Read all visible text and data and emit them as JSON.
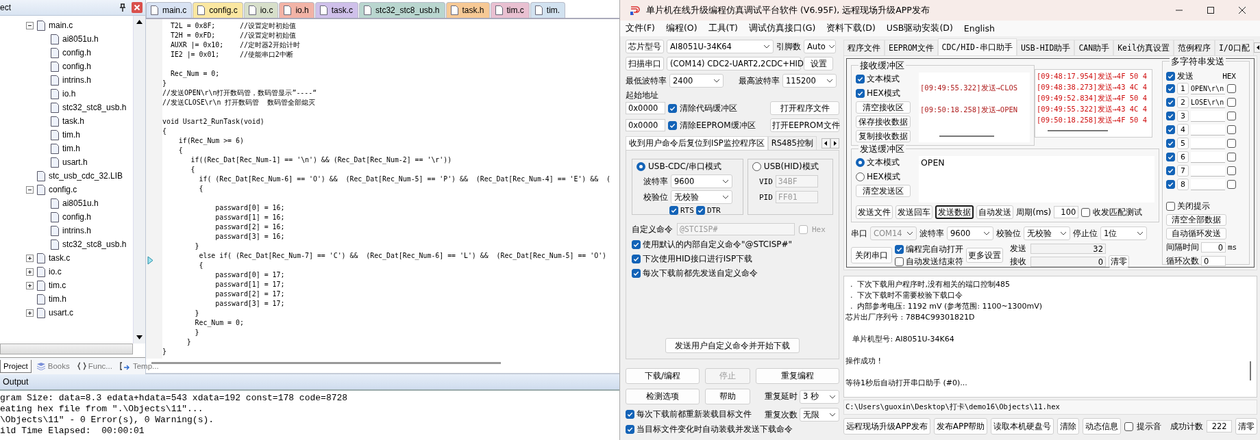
{
  "ide": {
    "project_panel": {
      "title": "ect",
      "tree": [
        {
          "label": "main.c",
          "expanded": true,
          "children": [
            {
              "label": "ai8051u.h"
            },
            {
              "label": "config.h"
            },
            {
              "label": "config.h"
            },
            {
              "label": "intrins.h"
            },
            {
              "label": "io.h"
            },
            {
              "label": "stc32_stc8_usb.h"
            },
            {
              "label": "task.h"
            },
            {
              "label": "tim.h"
            },
            {
              "label": "tim.h"
            },
            {
              "label": "usart.h"
            }
          ]
        },
        {
          "label": "stc_usb_cdc_32.LIB"
        },
        {
          "label": "config.c",
          "expanded": true,
          "children": [
            {
              "label": "ai8051u.h"
            },
            {
              "label": "config.h"
            },
            {
              "label": "intrins.h"
            },
            {
              "label": "stc32_stc8_usb.h"
            }
          ]
        },
        {
          "label": "task.c",
          "expanded": false
        },
        {
          "label": "io.c",
          "expanded": false
        },
        {
          "label": "tim.c",
          "expanded": false
        },
        {
          "label": "tim.h"
        },
        {
          "label": "usart.c",
          "expanded": false
        }
      ],
      "tabs": [
        {
          "label": "Project",
          "kind": "project",
          "selected": true
        },
        {
          "label": "Books",
          "kind": "books",
          "selected": false
        },
        {
          "label": "Func...",
          "kind": "functions",
          "selected": false
        },
        {
          "label": "Temp...",
          "kind": "templates",
          "selected": false
        }
      ]
    },
    "editor": {
      "tabs": [
        {
          "label": "main.c",
          "color": "#d9e3f3"
        },
        {
          "label": "config.c",
          "color": "#fbe7a1"
        },
        {
          "label": "io.c",
          "color": "#d7dfca"
        },
        {
          "label": "io.h",
          "color": "#f2b3a6"
        },
        {
          "label": "task.c",
          "color": "#cfc0ea"
        },
        {
          "label": "stc32_stc8_usb.h",
          "color": "#b9d6cf"
        },
        {
          "label": "task.h",
          "color": "#f7c995"
        },
        {
          "label": "tim.c",
          "color": "#e9c0d1"
        },
        {
          "label": "tim.",
          "color": "#d2e2f0"
        }
      ],
      "blocks": [
        [
          "  T2L = 0x8F;      //设置定时初始值",
          "  T2H = 0xFD;      //设置定时初始值",
          "  AUXR |= 0x10;    //定时器2开始计时",
          "  IE2 |= 0x01;     //使能串口2中断"
        ],
        [
          "  Rec_Num = 0;",
          "}",
          "//发送OPEN\\r\\n打开数码管，数码管显示”----“",
          "//发送CLOSE\\r\\n 打开数码管  数码管全部熄灭"
        ],
        [
          "void Usart2_RunTask(void)",
          "{",
          "    if(Rec_Num >= 6)",
          "    {",
          "       if((Rec_Dat[Rec_Num-1] == '\\n') && (Rec_Dat[Rec_Num-2] == '\\r'))",
          "       {",
          "         if( (Rec_Dat[Rec_Num-6] == 'O') &&  (Rec_Dat[Rec_Num-5] == 'P') &&  (Rec_Dat[Rec_Num-4] == 'E') &&  (",
          "         {"
        ],
        [
          "             passward[0] = 16;",
          "             passward[1] = 16;",
          "             passward[2] = 16;",
          "             passward[3] = 16;",
          "        }",
          "         else if( (Rec_Dat[Rec_Num-7] == 'C') &&  (Rec_Dat[Rec_Num-6] == 'L') &&  (Rec_Dat[Rec_Num-5] == 'O')",
          "         {",
          "             passward[0] = 17;",
          "             passward[1] = 17;",
          "             passward[2] = 17;",
          "             passward[3] = 17;",
          "        }",
          "        Rec_Num = 0;",
          "        }",
          "      }",
          "}"
        ]
      ]
    },
    "output": {
      "title": "Output",
      "lines": [
        "gram Size: data=8.3 edata+hdata=543 xdata=192 const=178 code=8728",
        "eating hex file from \".\\Objects\\11\"...",
        "\\Objects\\11\" - 0 Error(s), 0 Warning(s).",
        "ild Time Elapsed:  00:00:01"
      ]
    }
  },
  "isp": {
    "title": "单片机在线升级编程仿真调试平台软件 (V6.95F), 远程现场升级APP发布",
    "menu": [
      "文件(F)",
      "编程(O)",
      "工具(T)",
      "调试仿真接口(G)",
      "资料下载(D)",
      "USB驱动安装(D)",
      "English"
    ],
    "chip": {
      "button": "芯片型号",
      "value": "AI8051U-34K64",
      "pins_label": "引脚数",
      "pins": "Auto"
    },
    "port": {
      "button": "扫描串口",
      "value": "(COM14) CDC2-UART2,2CDC+HID",
      "settings": "设置"
    },
    "baud": {
      "min_label": "最低波特率",
      "min": "2400",
      "max_label": "最高波特率",
      "max": "115200"
    },
    "address": {
      "label": "起始地址",
      "rows": [
        {
          "value": "0x0000",
          "option": "清除代码缓冲区",
          "checked": true,
          "button": "打开程序文件"
        },
        {
          "value": "0x0000",
          "option": "清除EEPROM缓冲区",
          "checked": true,
          "button": "打开EEPROM文件"
        }
      ]
    },
    "option_tabs": [
      {
        "label": "收到用户命令后复位到ISP监控程序区",
        "selected": true
      },
      {
        "label": "RS485控制",
        "selected": false
      }
    ],
    "reset_panel": {
      "modes": [
        {
          "label": "USB-CDC/串口模式",
          "selected": true
        },
        {
          "label": "USB(HID)模式",
          "selected": false
        }
      ],
      "cdc": {
        "baud_label": "波特率",
        "baud": "9600",
        "parity_label": "校验位",
        "parity": "无校验",
        "signals": [
          {
            "label": "RTS",
            "checked": true
          },
          {
            "label": "DTR",
            "checked": true
          }
        ]
      },
      "hid": [
        {
          "label": "VID",
          "value": "34BF",
          "disabled": true
        },
        {
          "label": "PID",
          "value": "FF01",
          "disabled": true
        }
      ],
      "command": {
        "label": "自定义命令",
        "value": "@STCISP#",
        "disabled": true,
        "hex_label": "Hex",
        "hex_checked": false
      },
      "options": [
        {
          "label": "使用默认的内部自定义命令\"@STCISP#\"",
          "checked": true
        },
        {
          "label": "下次使用HID接口进行ISP下载",
          "checked": true
        },
        {
          "label": "每次下载前都先发送自定义命令",
          "checked": true
        }
      ],
      "send_button": "发送用户自定义命令并开始下载"
    },
    "actions": [
      {
        "label": "下载/编程",
        "disabled": false
      },
      {
        "label": "停止",
        "disabled": true
      },
      {
        "label": "重复编程",
        "disabled": false
      },
      {
        "label": "检测选项",
        "disabled": false
      },
      {
        "label": "帮助",
        "disabled": false
      }
    ],
    "repeat": [
      {
        "label": "重复延时",
        "value": "3 秒"
      },
      {
        "label": "重复次数",
        "value": "无限"
      }
    ],
    "bottom_options": [
      {
        "label": "每次下载前都重新装载目标文件",
        "checked": true
      },
      {
        "label": "当目标文件变化时自动装载并发送下载命令",
        "checked": true
      }
    ],
    "tool_tabs": [
      {
        "label": "程序文件",
        "selected": false
      },
      {
        "label": "EEPROM文件",
        "selected": false
      },
      {
        "label": "CDC/HID-串口助手",
        "selected": true
      },
      {
        "label": "USB-HID助手",
        "selected": false
      },
      {
        "label": "CAN助手",
        "selected": false
      },
      {
        "label": "Keil仿真设置",
        "selected": false
      },
      {
        "label": "范例程序",
        "selected": false
      },
      {
        "label": "I/O口配",
        "selected": false
      }
    ],
    "receive": {
      "title": "接收缓冲区",
      "modes": [
        {
          "label": "文本模式",
          "checked": true
        },
        {
          "label": "HEX模式",
          "checked": true
        }
      ],
      "buttons": [
        "清空接收区",
        "保存接收数据",
        "复制接收数据"
      ],
      "text_lines": [
        "[09:49:55.322]发送→CLOS",
        "[09:50:18.258]发送→OPEN"
      ],
      "hex_lines": [
        "[09:48:17.954]发送→4F 50 4",
        "[09:48:38.273]发送→43 4C 4",
        "[09:49:52.834]发送→4F 50 4",
        "[09:49:55.322]发送→43 4C 4",
        "[09:50:18.258]发送→4F 50 4"
      ]
    },
    "send": {
      "title": "发送缓冲区",
      "modes": [
        {
          "label": "文本模式",
          "selected": true
        },
        {
          "label": "HEX模式",
          "selected": false
        }
      ],
      "clear": "清空发送区",
      "value": "OPEN",
      "buttons": [
        {
          "label": "发送文件",
          "focused": false
        },
        {
          "label": "发送回车",
          "focused": false
        },
        {
          "label": "发送数据",
          "focused": true
        },
        {
          "label": "自动发送",
          "focused": false
        }
      ],
      "period_label": "周期(ms)",
      "period": "100",
      "match": {
        "label": "收发匹配测试",
        "checked": false
      }
    },
    "serial": {
      "fields": [
        {
          "label": "串口",
          "value": "COM14",
          "disabled": true
        },
        {
          "label": "波特率",
          "value": "9600",
          "disabled": false
        },
        {
          "label": "校验位",
          "value": "无校验",
          "disabled": false
        },
        {
          "label": "停止位",
          "value": "1位",
          "disabled": false
        }
      ],
      "close": "关闭串口",
      "options": [
        {
          "label": "编程完自动打开",
          "checked": true
        },
        {
          "label": "自动发送结束符",
          "checked": false
        }
      ],
      "more": "更多设置",
      "counters": [
        {
          "label": "发送",
          "value": "32"
        },
        {
          "label": "接收",
          "value": "0"
        }
      ],
      "reset": "清零"
    },
    "multi": {
      "title": "多字符串发送",
      "send_label": "发送",
      "send_checked": true,
      "hex_label": "HEX",
      "rows": [
        {
          "index": "1",
          "checked": true,
          "value": "OPEN\\r\\n",
          "hex": false
        },
        {
          "index": "2",
          "checked": true,
          "value": "LOSE\\r\\n",
          "hex": false
        },
        {
          "index": "3",
          "checked": true,
          "hex": false
        },
        {
          "index": "4",
          "checked": true,
          "hex": false
        },
        {
          "index": "5",
          "checked": true,
          "hex": false
        },
        {
          "index": "6",
          "checked": true,
          "hex": false
        },
        {
          "index": "7",
          "checked": true,
          "hex": false
        },
        {
          "index": "8",
          "checked": true,
          "hex": false
        }
      ],
      "hint": {
        "label": "关闭提示",
        "checked": false
      },
      "buttons": [
        "清空全部数据",
        "自动循环发送"
      ],
      "interval_label": "间隔时间",
      "interval": "0",
      "interval_unit": "ms",
      "loops_label": "循环次数",
      "loops": "0"
    },
    "log": [
      [
        "  .  下次下载用户程序时,没有相关的端口控制485",
        "  .  下次下载时不需要校验下载口令",
        "  .  内部参考电压: 1192 mV (参考范围: 1100~1300mV)",
        "芯片出厂序列号 : 78B4C99301821D"
      ],
      [
        "   单片机型号: AI8051U-34K64"
      ],
      [
        "操作成功 !"
      ],
      [
        "等待1秒后自动打开串口助手 (#0)..."
      ]
    ],
    "path": "C:\\Users\\guoxin\\Desktop\\打卡\\demo16\\Objects\\11.hex",
    "footer": {
      "buttons": [
        "远程现场升级APP发布",
        "发布APP帮助",
        "读取本机硬盘号",
        "清除",
        "动态信息"
      ],
      "sound": {
        "label": "提示音",
        "checked": false
      },
      "count_label": "成功计数",
      "count": "222",
      "reset": "清零"
    }
  }
}
